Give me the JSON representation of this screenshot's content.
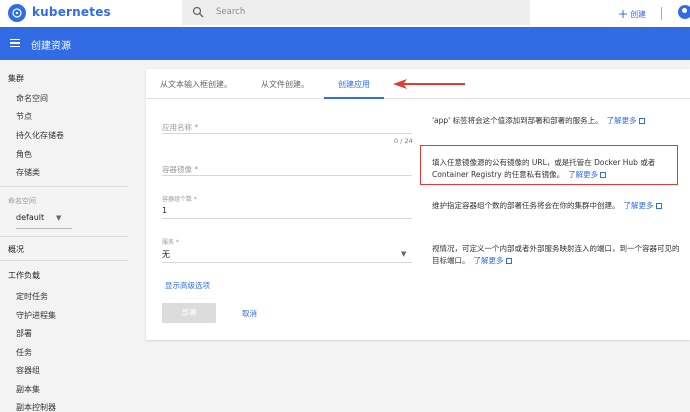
{
  "brand": {
    "name": "kubernetes"
  },
  "search": {
    "placeholder": "Search"
  },
  "header": {
    "create_label": "创建"
  },
  "titlebar": {
    "title": "创建资源"
  },
  "sidebar": {
    "cluster_heading": "集群",
    "cluster_items": [
      "命名空间",
      "节点",
      "持久化存储卷",
      "角色",
      "存储类"
    ],
    "namespace_label": "命名空间",
    "namespace_value": "default",
    "overview": "概况",
    "workloads_heading": "工作负载",
    "workload_items": [
      "定时任务",
      "守护进程集",
      "部署",
      "任务",
      "容器组",
      "副本集",
      "副本控制器"
    ]
  },
  "tabs": [
    "从文本输入框创建。",
    "从文件创建。",
    "创建应用"
  ],
  "form": {
    "app_name_label": "应用名称 *",
    "app_name_counter": "0 / 24",
    "image_label": "容器镜像 *",
    "pods_label": "容器组个数 *",
    "pods_value": "1",
    "service_label": "服务 *",
    "service_value": "无",
    "advanced_link": "显示高级选项",
    "deploy_button": "部署",
    "cancel_button": "取消"
  },
  "help": {
    "h1": "'app' 标签将会这个值添加到部署和部署的服务上。",
    "h2": "填入任意镜像源的公有镜像的 URL，或是托管在 Docker Hub 或者 Container Registry 的任意私有镜像。",
    "h3": "维护指定容器组个数的部署任务将会在你的集群中创建。",
    "h4": "视情况，可定义一个内部或者外部服务映射连入的端口，到一个容器可见的目标端口。",
    "learn_more": "了解更多"
  },
  "colors": {
    "accent": "#326ce5",
    "highlight": "#e53935"
  }
}
